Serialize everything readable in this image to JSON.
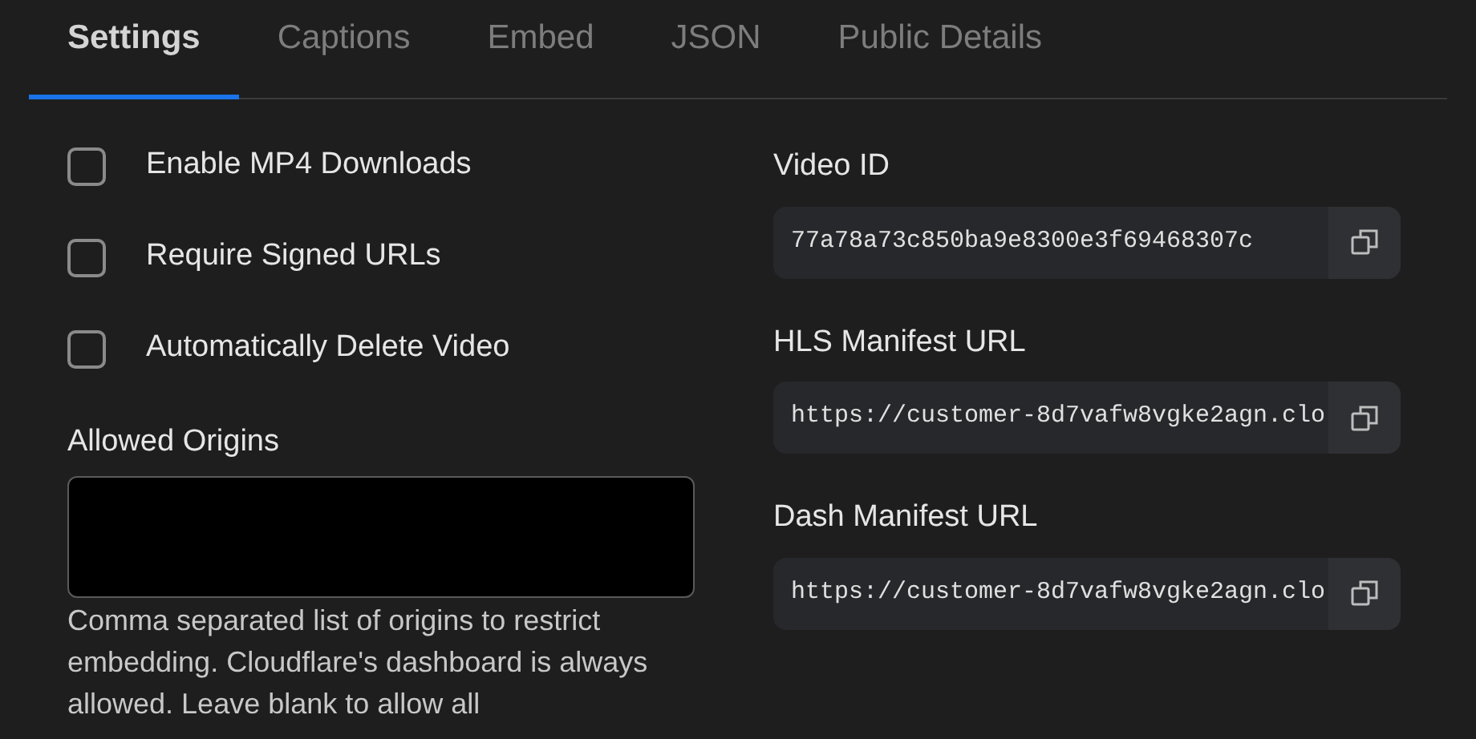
{
  "tabs": [
    {
      "label": "Settings",
      "selected": true
    },
    {
      "label": "Captions",
      "selected": false
    },
    {
      "label": "Embed",
      "selected": false
    },
    {
      "label": "JSON",
      "selected": false
    },
    {
      "label": "Public Details",
      "selected": false
    }
  ],
  "options": [
    {
      "label": "Enable MP4 Downloads",
      "checked": false
    },
    {
      "label": "Require Signed URLs",
      "checked": false
    },
    {
      "label": "Automatically Delete Video",
      "checked": false
    }
  ],
  "allowed_origins": {
    "label": "Allowed Origins",
    "help": "Comma separated list of origins to restrict embedding. Cloudflare's dashboard is always allowed. Leave blank to allow all"
  },
  "fields": [
    {
      "label": "Video ID",
      "value": "77a78a73c850ba9e8300e3f69468307c"
    },
    {
      "label": "HLS Manifest URL",
      "value": "https://customer-8d7vafw8vgke2agn.clo"
    },
    {
      "label": "Dash Manifest URL",
      "value": "https://customer-8d7vafw8vgke2agn.clo"
    }
  ]
}
